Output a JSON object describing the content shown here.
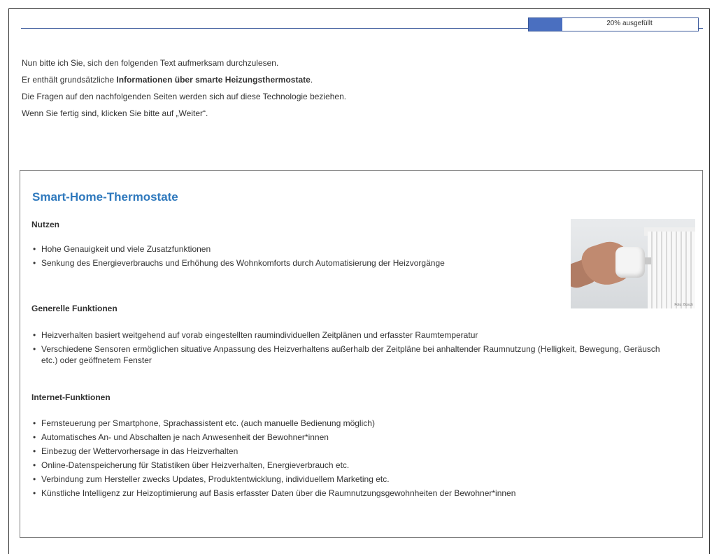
{
  "progress": {
    "fraction": 0.2,
    "label": "20% ausgefüllt"
  },
  "intro": {
    "line1": "Nun bitte ich Sie, sich den folgenden Text aufmerksam durchzulesen.",
    "line2_prefix": "Er enthält grundsätzliche ",
    "line2_bold": "Informationen über smarte Heizungsthermostate",
    "line2_suffix": ".",
    "line3": "Die Fragen auf den nachfolgenden Seiten werden sich auf diese Technologie beziehen.",
    "line4": "Wenn Sie fertig sind, klicken Sie bitte auf „Weiter“."
  },
  "info": {
    "title": "Smart-Home-Thermostate",
    "image": {
      "icon": "thermostat-photo",
      "credit": "Foto: Bosch"
    },
    "sections": [
      {
        "heading": "Nutzen",
        "items": [
          "Hohe Genauigkeit und viele Zusatzfunktionen",
          "Senkung des Energieverbrauchs und Erhöhung des Wohnkomforts durch Automatisierung der Heizvorgänge"
        ]
      },
      {
        "heading": "Generelle Funktionen",
        "items": [
          "Heizverhalten basiert weitgehend auf vorab eingestellten raumindividuellen Zeitplänen und erfasster Raumtemperatur",
          "Verschiedene Sensoren ermöglichen situative Anpassung des Heizverhaltens außerhalb der Zeitpläne bei anhaltender Raumnutzung (Helligkeit, Bewegung, Geräusch etc.) oder geöffnetem Fenster"
        ]
      },
      {
        "heading": "Internet-Funktionen",
        "items": [
          "Fernsteuerung per Smartphone, Sprachassistent etc. (auch manuelle Bedienung möglich)",
          "Automatisches An- und Abschalten je nach Anwesenheit der Bewohner*innen",
          "Einbezug der Wettervorhersage in das Heizverhalten",
          "Online-Datenspeicherung für Statistiken über Heizverhalten, Energieverbrauch etc.",
          "Verbindung zum Hersteller zwecks Updates, Produktentwicklung, individuellem Marketing etc.",
          "Künstliche Intelligenz zur Heizoptimierung auf Basis erfasster Daten über die Raumnutzungsgewohnheiten der Bewohner*innen"
        ]
      }
    ]
  },
  "colors": {
    "accent": "#2f79bd",
    "progress_fill": "#4a6fc0",
    "rule": "#39589a"
  }
}
